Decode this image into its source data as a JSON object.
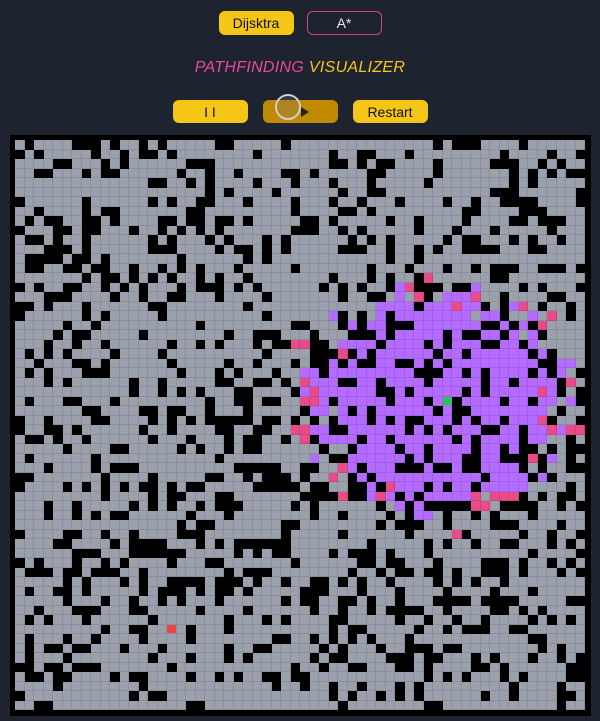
{
  "algorithms": {
    "dijkstra_label": "Dijsktra",
    "astar_label": "A*",
    "selected": "Dijsktra"
  },
  "title": {
    "part1": "PATHFINDING",
    "part2": "VISUALIZER"
  },
  "controls": {
    "pause_label": "I I",
    "play_label": "",
    "restart_label": "Restart"
  },
  "colors": {
    "background": "#1e2330",
    "accent": "#f5c518",
    "pink": "#ec4899",
    "empty_cell": "#9aa1ac",
    "wall": "#000000",
    "visited": "#b46cff",
    "frontier": "#e84b8a",
    "start": "#22c55e",
    "end": "#ef4444"
  },
  "grid": {
    "rows": 60,
    "cols": 60,
    "start": {
      "row": 27,
      "col": 45
    },
    "end": {
      "row": 51,
      "col": 16
    },
    "visited_center": {
      "row": 27,
      "col": 44
    }
  }
}
